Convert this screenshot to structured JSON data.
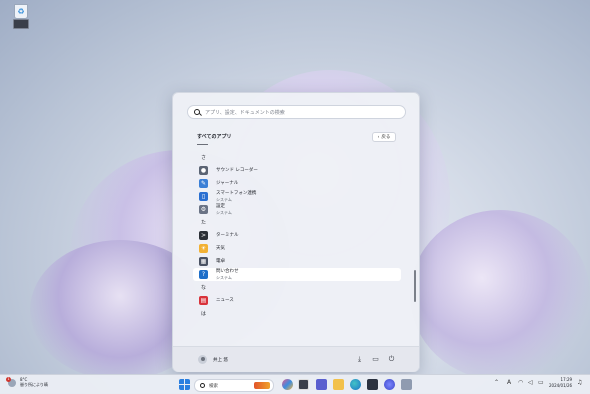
{
  "desktop": {
    "icons": [
      "recycle-bin-icon",
      "app-icon"
    ]
  },
  "start_menu": {
    "search_placeholder": "アプリ、設定、ドキュメントの検索",
    "all_apps_title": "すべてのアプリ",
    "back_label": "戻る",
    "items": [
      {
        "type": "letter",
        "label": "さ"
      },
      {
        "type": "app",
        "label": "サウンド レコーダー",
        "icon": "microphone-icon",
        "color": "#5b6474"
      },
      {
        "type": "app",
        "label": "ジャーナル",
        "icon": "journal-icon",
        "color": "#3b7fd6"
      },
      {
        "type": "app",
        "label": "スマートフォン連携",
        "sub": "システム",
        "icon": "phone-link-icon",
        "color": "#2a6fd1"
      },
      {
        "type": "app",
        "label": "設定",
        "sub": "システム",
        "icon": "gear-icon",
        "color": "#6a7385"
      },
      {
        "type": "letter",
        "label": "た"
      },
      {
        "type": "app",
        "label": "ターミナル",
        "icon": "terminal-icon",
        "color": "#2b2f36"
      },
      {
        "type": "app",
        "label": "天気",
        "icon": "weather-icon",
        "color": "#f2b134"
      },
      {
        "type": "app",
        "label": "電卓",
        "icon": "calculator-icon",
        "color": "#4a5263"
      },
      {
        "type": "app",
        "label": "問い合わせ",
        "sub": "システム",
        "icon": "help-icon",
        "color": "#1f6fc9",
        "selected": true
      },
      {
        "type": "letter",
        "label": "な"
      },
      {
        "type": "app",
        "label": "ニュース",
        "icon": "news-icon",
        "color": "#d8333b"
      },
      {
        "type": "letter",
        "label": "は"
      }
    ],
    "user_name": "井上 悠",
    "footer_icons": [
      "download-icon",
      "folder-icon",
      "power-icon"
    ]
  },
  "taskbar": {
    "weather_temp": "8°C",
    "weather_text": "曇り所により晴",
    "weather_badge": "1",
    "search_label": "検索",
    "apps": [
      "start-icon",
      "widgets-icon",
      "copilot-icon",
      "task-view-icon",
      "teams-icon",
      "file-explorer-icon",
      "edge-icon",
      "store-icon",
      "app1-icon",
      "app2-icon"
    ],
    "tray_icons": [
      "chevron-up-icon",
      "ime-icon",
      "network-icon",
      "volume-icon",
      "battery-icon"
    ],
    "ime_label": "A",
    "time": "17:29",
    "date": "2024/01/26"
  },
  "colors": {
    "accent": "#2a6fd1",
    "menu_bg": "#eef0f6"
  }
}
